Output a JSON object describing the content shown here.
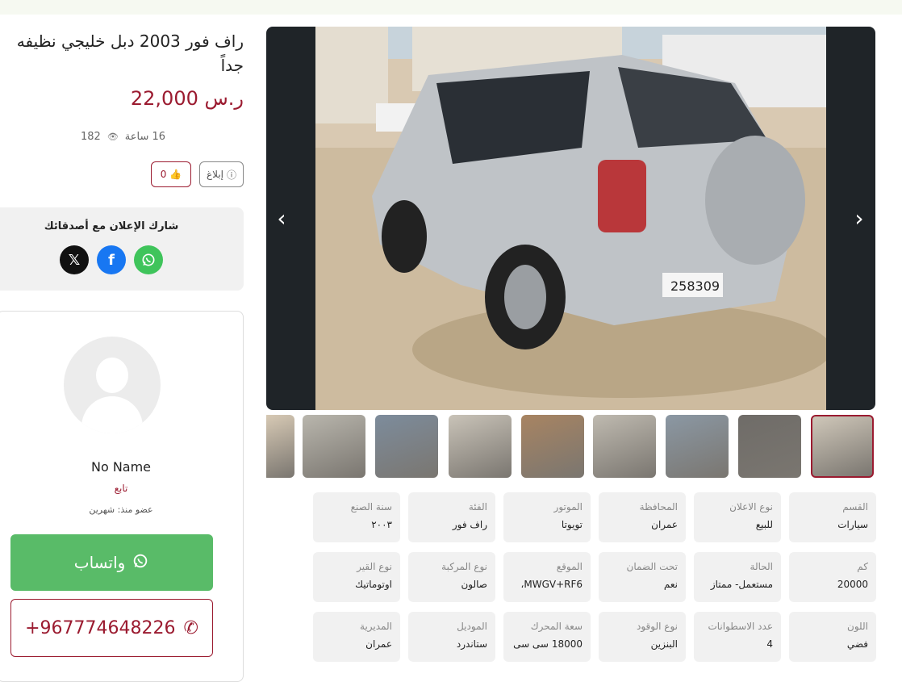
{
  "listing": {
    "title": "راف فور 2003 دبل خليجي نظيفه جداً",
    "price": "22,000 ر.س",
    "views": "182",
    "time_ago": "16 ساعة"
  },
  "actions": {
    "like_count": "0",
    "report_label": "إبلاغ"
  },
  "share": {
    "title": "شارك الإعلان مع أصدقائك",
    "icons": [
      "x-icon",
      "facebook-icon",
      "whatsapp-icon"
    ]
  },
  "seller": {
    "name": "No Name",
    "type": "تابع",
    "member_since": "عضو منذ: شهرين",
    "whatsapp_label": "واتساب",
    "phone": "+967774648226"
  },
  "gallery": {
    "prev_icon": "chevron-left-icon",
    "next_icon": "chevron-right-icon",
    "thumbnail_count": 9
  },
  "specs": [
    {
      "label": "القسم",
      "value": "سيارات"
    },
    {
      "label": "نوع الاعلان",
      "value": "للبيع"
    },
    {
      "label": "المحافظة",
      "value": "عمران"
    },
    {
      "label": "الموتور",
      "value": "تويوتا"
    },
    {
      "label": "الفئة",
      "value": "راف فور"
    },
    {
      "label": "سنة الصنع",
      "value": "٢٠٠٣"
    },
    {
      "label": "كم",
      "value": "20000"
    },
    {
      "label": "الحالة",
      "value": "مستعمل- ممتاز"
    },
    {
      "label": "تحت الضمان",
      "value": "نعم"
    },
    {
      "label": "الموقع",
      "value": "MWGV+RF6، "
    },
    {
      "label": "نوع المركبة",
      "value": "صالون"
    },
    {
      "label": "نوع القير",
      "value": "اوتوماتيك"
    },
    {
      "label": "اللون",
      "value": "فضي"
    },
    {
      "label": "عدد الاسطوانات",
      "value": "4"
    },
    {
      "label": "نوع الوقود",
      "value": "البنزين"
    },
    {
      "label": "سعة المحرك",
      "value": "18000 سى سى"
    },
    {
      "label": "الموديل",
      "value": "ستاندرد"
    },
    {
      "label": "المديرية",
      "value": "عمران"
    }
  ],
  "colors": {
    "brand": "#9b1b30",
    "whatsapp": "#59bb68",
    "facebook": "#1877f2"
  }
}
